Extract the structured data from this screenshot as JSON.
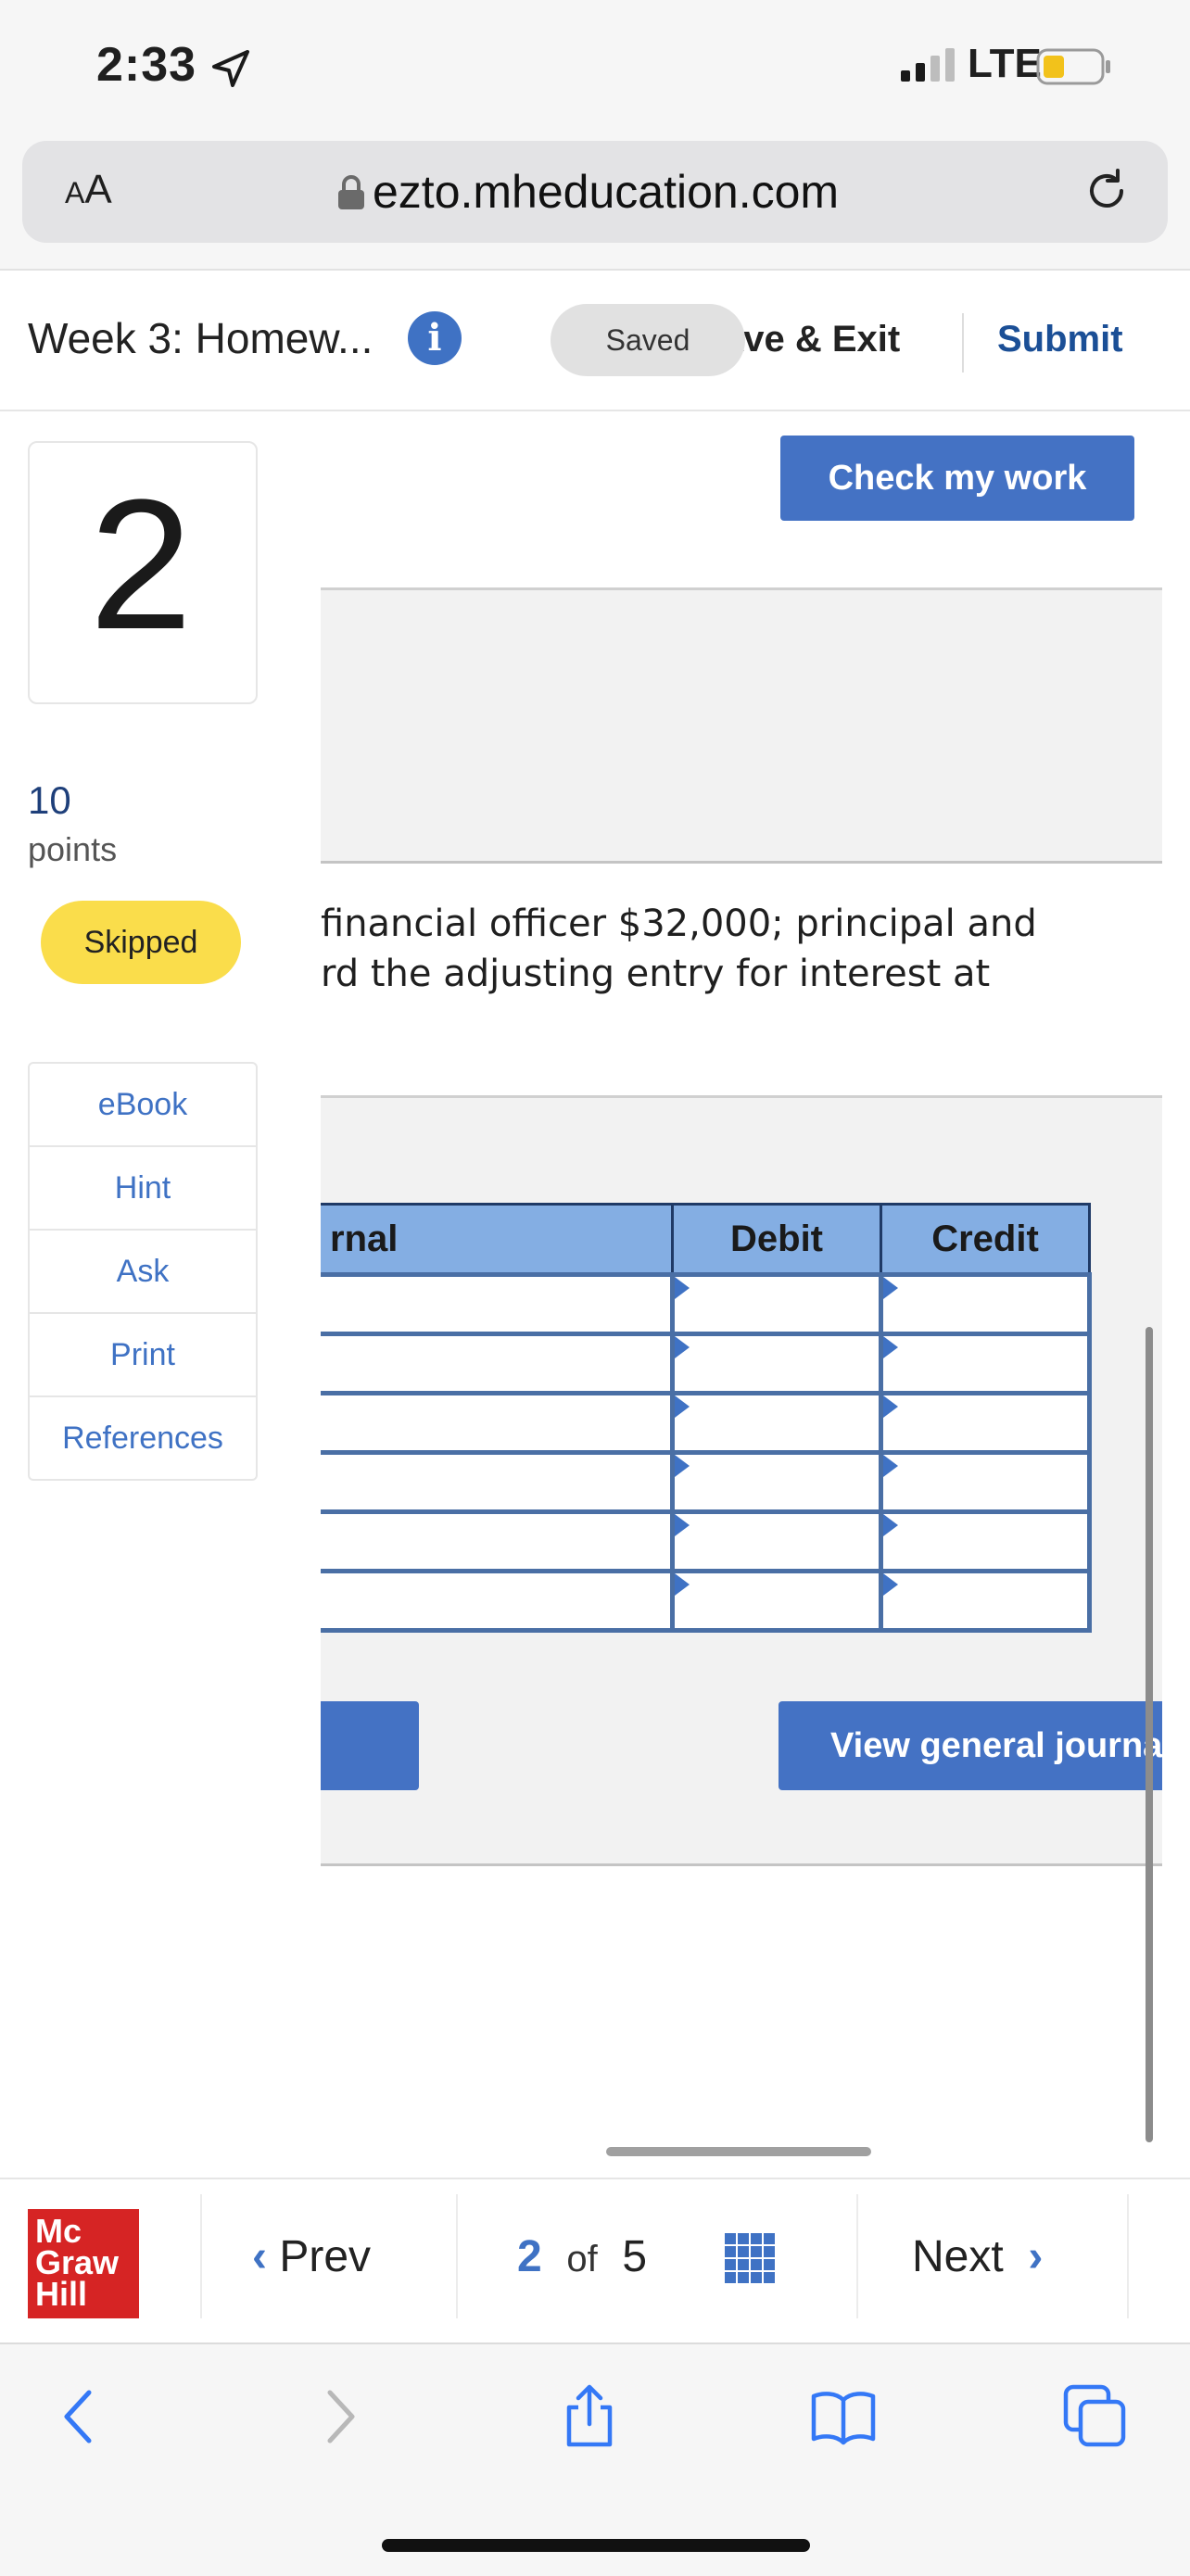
{
  "status_bar": {
    "time": "2:33",
    "carrier": "LTE"
  },
  "browser": {
    "text_size_label_small": "A",
    "text_size_label_large": "A",
    "url": "ezto.mheducation.com"
  },
  "header": {
    "title": "Week 3: Homew...",
    "info_label": "i",
    "saved_label": "Saved",
    "save_exit_label": "ave & Exit",
    "submit_label": "Submit"
  },
  "question": {
    "number": "2",
    "points_value": "10",
    "points_label": "points",
    "status": "Skipped",
    "text_line1": "financial officer $32,000; principal and",
    "text_line2": "rd the adjusting entry for interest at"
  },
  "side_links": [
    {
      "label": "eBook"
    },
    {
      "label": "Hint"
    },
    {
      "label": "Ask"
    },
    {
      "label": "Print"
    },
    {
      "label": "References"
    }
  ],
  "check_button_label": "Check my work",
  "journal": {
    "columns": {
      "journal": "rnal",
      "debit": "Debit",
      "credit": "Credit"
    },
    "row_count": 6
  },
  "view_journal_label": "View general journa",
  "bottom_nav": {
    "logo_lines": [
      "Mc",
      "Graw",
      "Hill"
    ],
    "prev_label": "Prev",
    "current_page": "2",
    "of_label": "of",
    "total_pages": "5",
    "next_label": "Next"
  },
  "colors": {
    "accent": "#4472c4",
    "header_blue": "#84aee3",
    "skipped_yellow": "#fadd4b",
    "logo_red": "#d62424"
  }
}
